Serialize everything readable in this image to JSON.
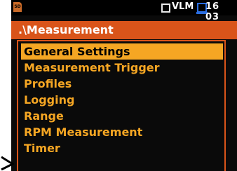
{
  "status": {
    "sd_label": "SD",
    "mode": "VLM",
    "time": "16 03"
  },
  "header": {
    "path": ".\\Measurement"
  },
  "menu": {
    "items": [
      {
        "label": "General Settings",
        "selected": true
      },
      {
        "label": "Measurement Trigger",
        "selected": false
      },
      {
        "label": "Profiles",
        "selected": false
      },
      {
        "label": "Logging",
        "selected": false
      },
      {
        "label": "Range",
        "selected": false
      },
      {
        "label": "RPM Measurement",
        "selected": false
      },
      {
        "label": "Timer",
        "selected": false
      }
    ]
  },
  "colors": {
    "accent": "#d9541a",
    "menu_text": "#f5a623",
    "selection": "#f5a623",
    "usb": "#2a6de0"
  }
}
